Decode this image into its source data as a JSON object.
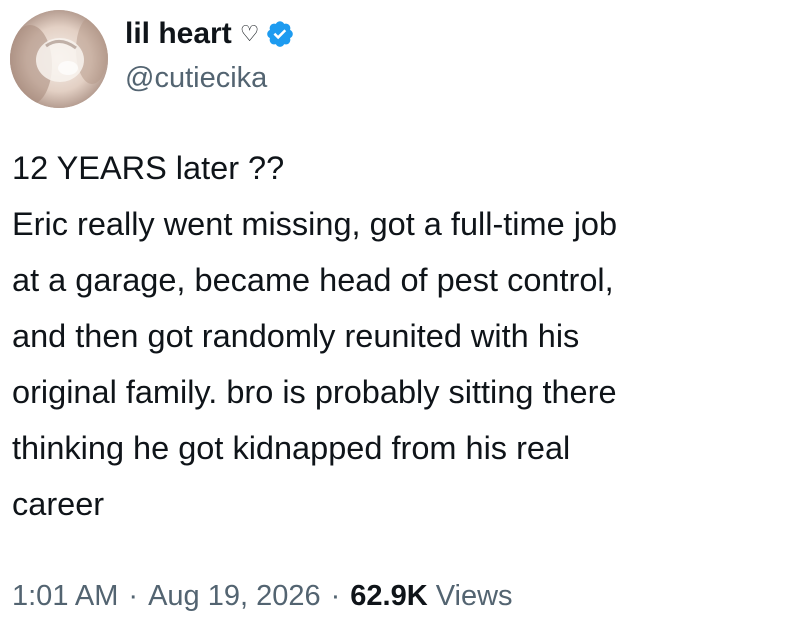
{
  "author": {
    "display_name": "lil heart",
    "name_emoji": "♡",
    "handle": "@cutiecika",
    "verified": true,
    "verified_color": "#1d9bf0"
  },
  "tweet": {
    "text": "12 YEARS later ??\nEric really went missing, got a full-time job\nat a garage, became head of pest control,\nand then got randomly reunited with his\noriginal family. bro is probably sitting there\nthinking he got kidnapped from his real\ncareer"
  },
  "meta": {
    "time": "1:01 AM",
    "separator": "·",
    "date": "Aug 19, 2026",
    "views_count": "62.9K",
    "views_label": "Views"
  },
  "colors": {
    "text_primary": "#0f1419",
    "text_secondary": "#536471",
    "background": "#ffffff"
  }
}
